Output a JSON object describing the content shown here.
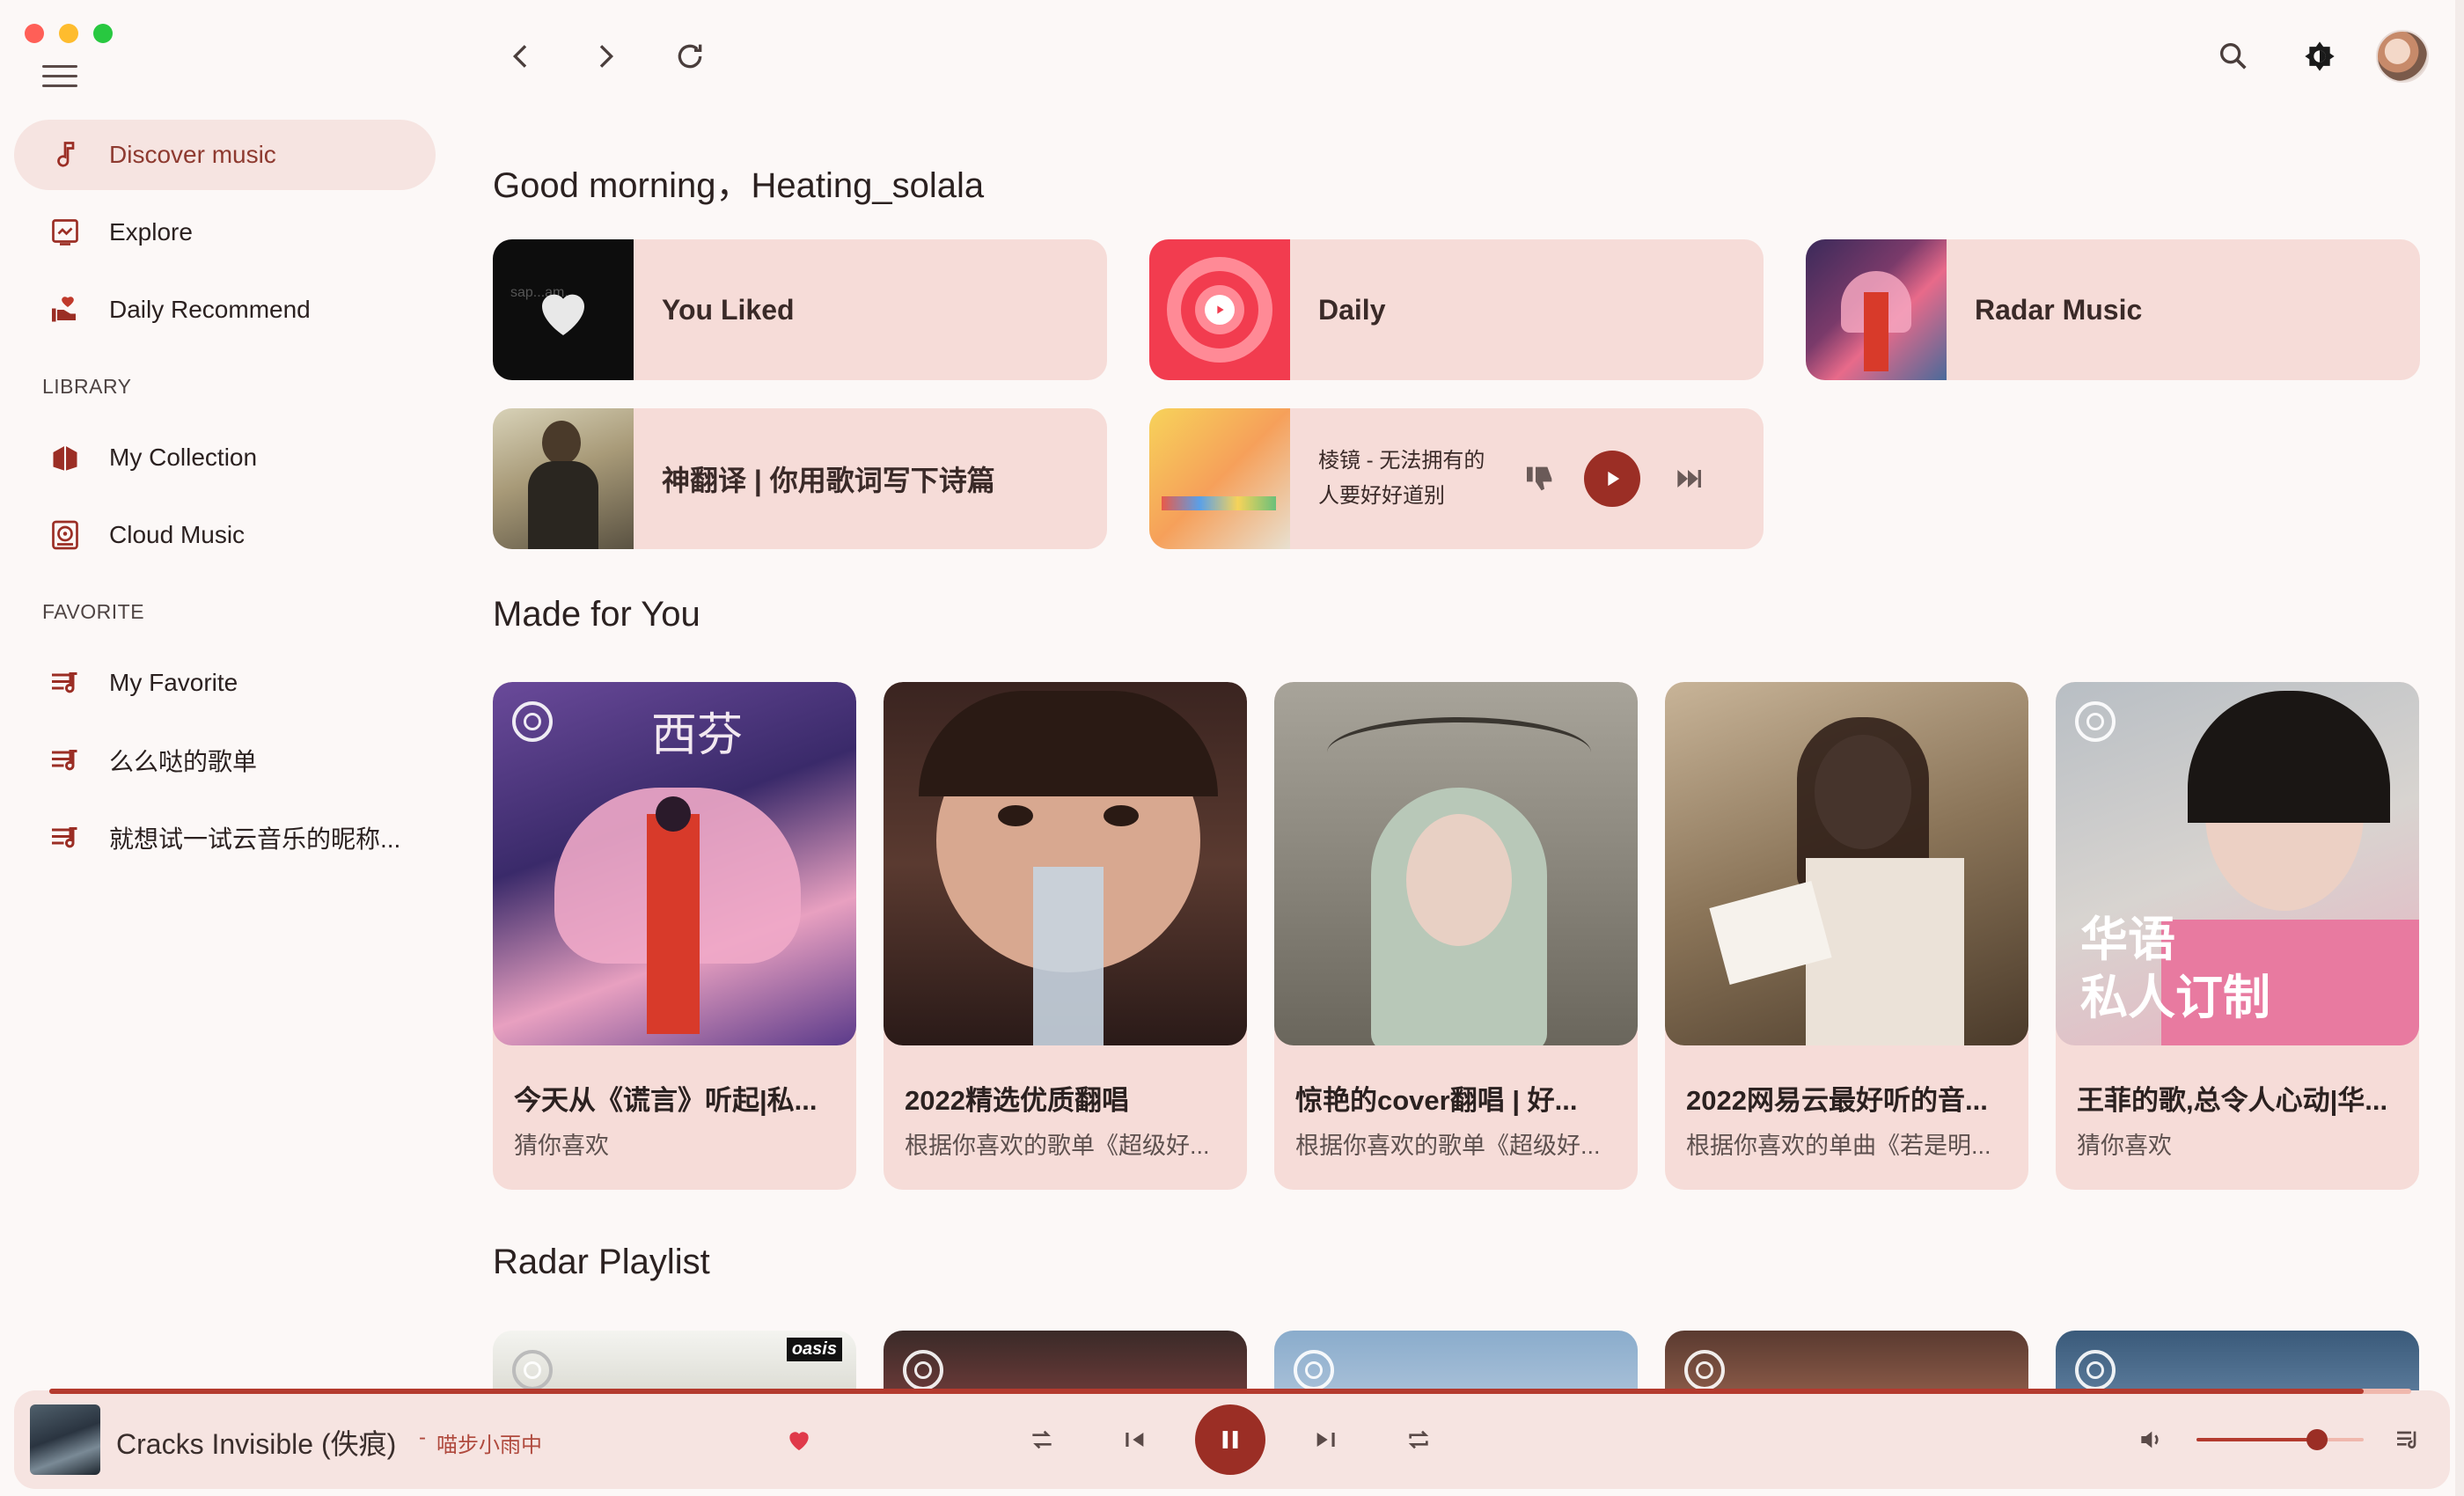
{
  "app": {
    "theme": {
      "accent": "#9b2e25",
      "surface": "#f6dcd8",
      "background": "#fcf8f7"
    }
  },
  "sidebar": {
    "items": [
      {
        "label": "Discover music",
        "icon": "music-note-icon",
        "active": true
      },
      {
        "label": "Explore",
        "icon": "explore-icon",
        "active": false
      },
      {
        "label": "Daily Recommend",
        "icon": "hand-heart-icon",
        "active": false
      }
    ],
    "library_label": "LIBRARY",
    "library": [
      {
        "label": "My Collection",
        "icon": "collection-icon"
      },
      {
        "label": "Cloud Music",
        "icon": "cloud-music-icon"
      }
    ],
    "favorite_label": "FAVORITE",
    "favorite": [
      {
        "label": "My Favorite",
        "icon": "playlist-icon"
      },
      {
        "label": "么么哒的歌单",
        "icon": "playlist-icon"
      },
      {
        "label": "就想试一试云音乐的昵称...",
        "icon": "playlist-icon"
      }
    ]
  },
  "main": {
    "greeting": "Good morning，Heating_solala",
    "quick": {
      "liked": "You Liked",
      "daily": "Daily",
      "radar": "Radar Music",
      "playlist": "神翻译 | 你用歌词写下诗篇",
      "fm_line1": "棱镜 - 无法拥有的",
      "fm_line2": "人要好好道别",
      "liked_cover_text": "sap...am."
    },
    "made_for_you_title": "Made for You",
    "playlists": [
      {
        "title": "今天从《谎言》听起|私...",
        "subtitle": "猜你喜欢",
        "cover_text": "西芬"
      },
      {
        "title": "2022精选优质翻唱",
        "subtitle": "根据你喜欢的歌单《超级好..."
      },
      {
        "title": "惊艳的cover翻唱 | 好...",
        "subtitle": "根据你喜欢的歌单《超级好..."
      },
      {
        "title": "2022网易云最好听的音...",
        "subtitle": "根据你喜欢的单曲《若是明..."
      },
      {
        "title": "王菲的歌,总令人心动|华...",
        "subtitle": "猜你喜欢",
        "cover_text_1": "华语",
        "cover_text_2": "私人订制"
      }
    ],
    "radar_title": "Radar Playlist",
    "radar_cover_text": "oasis"
  },
  "player": {
    "song": "Cracks Invisible (佚痕)",
    "dash": "-",
    "artist": "喵步小雨中",
    "progress": 0.98,
    "volume": 0.72,
    "liked": true,
    "playing": true
  }
}
